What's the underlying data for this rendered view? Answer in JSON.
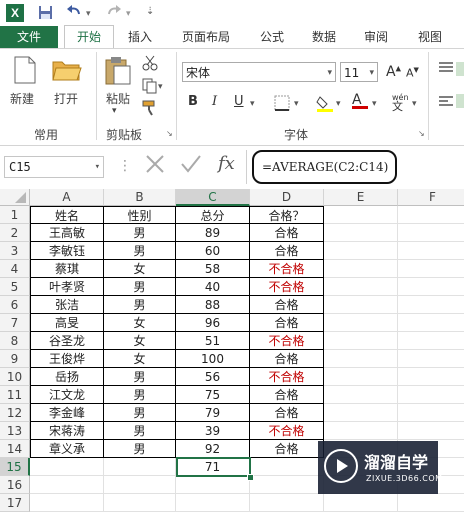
{
  "quick_access": {
    "logo": "X"
  },
  "tabs": [
    "文件",
    "开始",
    "插入",
    "页面布局",
    "公式",
    "数据",
    "审阅",
    "视图"
  ],
  "ribbon": {
    "new_label": "新建",
    "open_label": "打开",
    "paste_label": "粘贴",
    "group_common": "常用",
    "group_clipboard": "剪贴板",
    "group_font": "字体",
    "font_name": "宋体",
    "font_size": "11",
    "bold": "B",
    "italic": "I",
    "underline": "U",
    "grow": "A",
    "shrink": "A",
    "font_color": "A",
    "wen": "wén"
  },
  "formula_bar": {
    "cell_ref": "C15",
    "fx": "fx",
    "formula": "=AVERAGE(C2:C14)"
  },
  "columns": [
    "A",
    "B",
    "C",
    "D",
    "E",
    "F"
  ],
  "rows": [
    "1",
    "2",
    "3",
    "4",
    "5",
    "6",
    "7",
    "8",
    "9",
    "10",
    "11",
    "12",
    "13",
    "14",
    "15",
    "16",
    "17"
  ],
  "table": {
    "headers": [
      "姓名",
      "性别",
      "总分",
      "合格？"
    ],
    "records": [
      [
        "王高敏",
        "男",
        "89",
        "合格"
      ],
      [
        "李敏钰",
        "男",
        "60",
        "合格"
      ],
      [
        "蔡琪",
        "女",
        "58",
        "不合格"
      ],
      [
        "叶孝贤",
        "男",
        "40",
        "不合格"
      ],
      [
        "张洁",
        "男",
        "88",
        "合格"
      ],
      [
        "高旻",
        "女",
        "96",
        "合格"
      ],
      [
        "谷圣龙",
        "女",
        "51",
        "不合格"
      ],
      [
        "王俊烨",
        "女",
        "100",
        "合格"
      ],
      [
        "岳扬",
        "男",
        "56",
        "不合格"
      ],
      [
        "江文龙",
        "男",
        "75",
        "合格"
      ],
      [
        "李金峰",
        "男",
        "79",
        "合格"
      ],
      [
        "宋蒋涛",
        "男",
        "39",
        "不合格"
      ],
      [
        "章义承",
        "男",
        "92",
        "合格"
      ]
    ],
    "average": "71"
  },
  "watermark": {
    "title": "溜溜自学",
    "url": "ZIXUE.3D66.COM"
  },
  "colors": {
    "excel_green": "#217346",
    "fail_red": "#c00000"
  }
}
